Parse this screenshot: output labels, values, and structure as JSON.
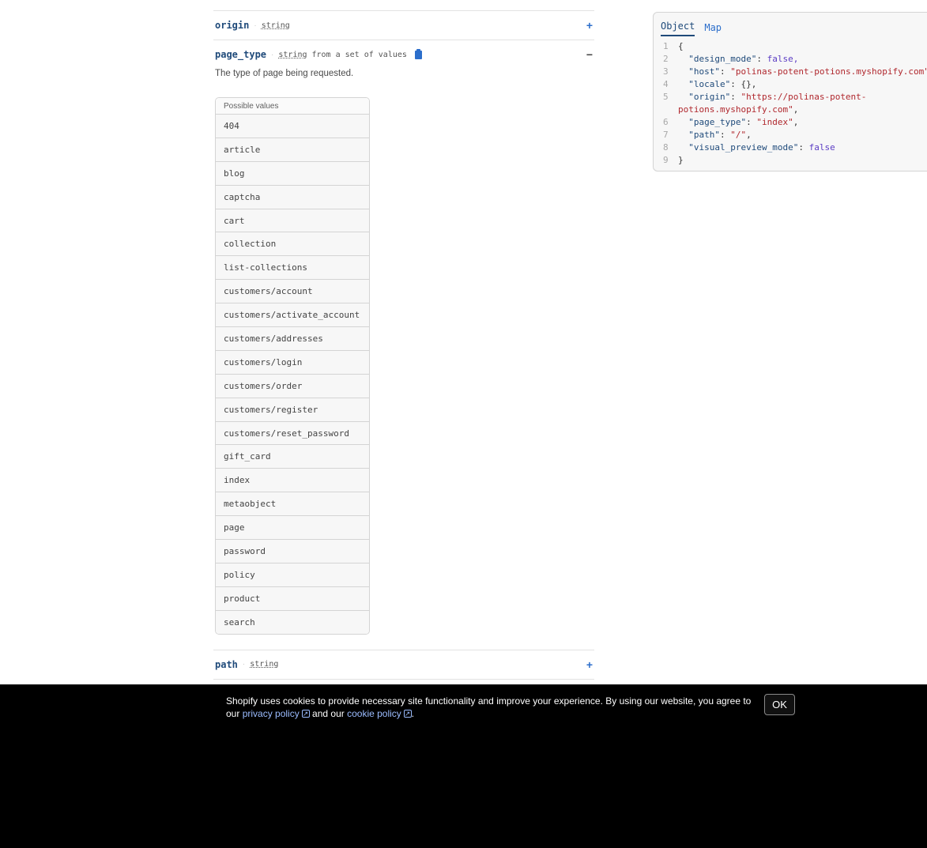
{
  "properties": {
    "origin": {
      "name": "origin",
      "type": "string",
      "toggle": "+"
    },
    "page_type": {
      "name": "page_type",
      "type": "string",
      "type_extra": "from a set of values",
      "toggle": "−",
      "description": "The type of page being requested.",
      "values_header": "Possible values",
      "values": [
        "404",
        "article",
        "blog",
        "captcha",
        "cart",
        "collection",
        "list-collections",
        "customers/account",
        "customers/activate_account",
        "customers/addresses",
        "customers/login",
        "customers/order",
        "customers/register",
        "customers/reset_password",
        "gift_card",
        "index",
        "metaobject",
        "page",
        "password",
        "policy",
        "product",
        "search"
      ]
    },
    "path": {
      "name": "path",
      "type": "string",
      "toggle": "+"
    }
  },
  "code_panel": {
    "tabs": [
      "Object",
      "Map"
    ],
    "active_tab": "Object",
    "lines": [
      {
        "n": "1",
        "text": "{"
      },
      {
        "n": "2",
        "key": "\"design_mode\"",
        "val": "false,",
        "kind": "bool"
      },
      {
        "n": "3",
        "key": "\"host\"",
        "val": "\"polinas-potent-potions.myshopify.com\"",
        "kind": "str"
      },
      {
        "n": "4",
        "key": "\"locale\"",
        "val": "{},",
        "kind": "plain"
      },
      {
        "n": "5",
        "key": "\"origin\"",
        "val": "\"https://polinas-potent-",
        "kind": "str"
      },
      {
        "n": "",
        "cont": "potions.myshopify.com\"",
        "tail": ","
      },
      {
        "n": "6",
        "key": "\"page_type\"",
        "val": "\"index\"",
        "tail": ",",
        "kind": "str"
      },
      {
        "n": "7",
        "key": "\"path\"",
        "val": "\"/\"",
        "tail": ",",
        "kind": "str"
      },
      {
        "n": "8",
        "key": "\"visual_preview_mode\"",
        "val": "false",
        "kind": "bool"
      },
      {
        "n": "9",
        "text": "}"
      }
    ]
  },
  "cookie_banner": {
    "text_before": "Shopify uses cookies to provide necessary site functionality and improve your experience. By using our website, you agree to our ",
    "privacy_link": "privacy policy",
    "text_middle": " and our ",
    "cookie_link": "cookie policy",
    "text_after": ".",
    "ok_label": "OK"
  }
}
